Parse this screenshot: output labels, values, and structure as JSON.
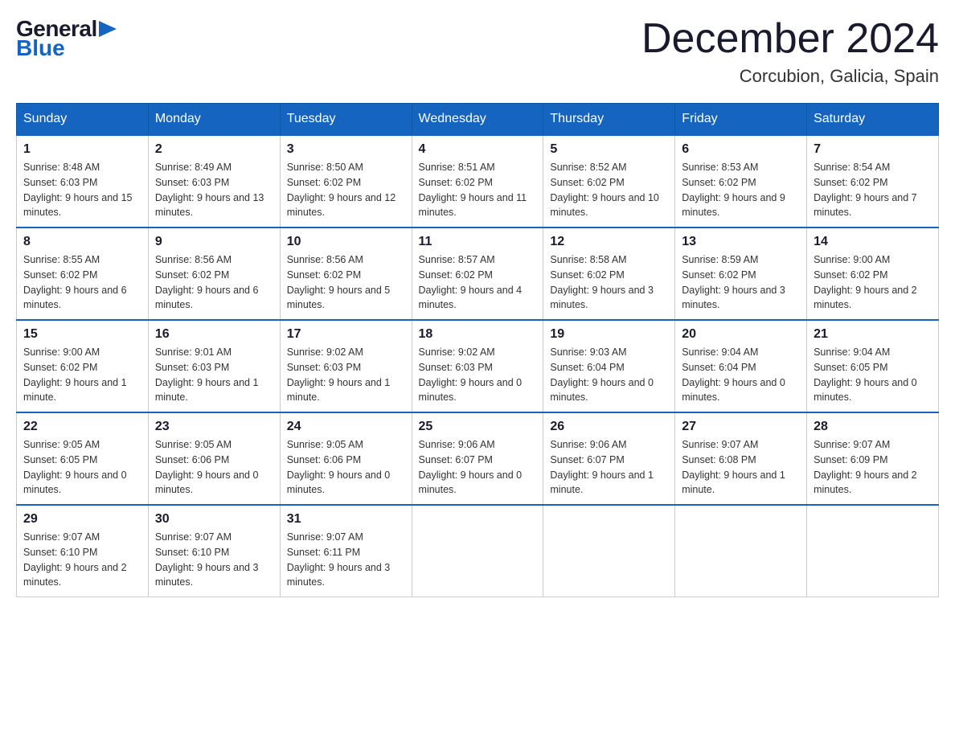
{
  "logo": {
    "general": "General",
    "blue": "Blue"
  },
  "title": "December 2024",
  "location": "Corcubion, Galicia, Spain",
  "days_of_week": [
    "Sunday",
    "Monday",
    "Tuesday",
    "Wednesday",
    "Thursday",
    "Friday",
    "Saturday"
  ],
  "weeks": [
    [
      {
        "day": "1",
        "sunrise": "8:48 AM",
        "sunset": "6:03 PM",
        "daylight": "9 hours and 15 minutes."
      },
      {
        "day": "2",
        "sunrise": "8:49 AM",
        "sunset": "6:03 PM",
        "daylight": "9 hours and 13 minutes."
      },
      {
        "day": "3",
        "sunrise": "8:50 AM",
        "sunset": "6:02 PM",
        "daylight": "9 hours and 12 minutes."
      },
      {
        "day": "4",
        "sunrise": "8:51 AM",
        "sunset": "6:02 PM",
        "daylight": "9 hours and 11 minutes."
      },
      {
        "day": "5",
        "sunrise": "8:52 AM",
        "sunset": "6:02 PM",
        "daylight": "9 hours and 10 minutes."
      },
      {
        "day": "6",
        "sunrise": "8:53 AM",
        "sunset": "6:02 PM",
        "daylight": "9 hours and 9 minutes."
      },
      {
        "day": "7",
        "sunrise": "8:54 AM",
        "sunset": "6:02 PM",
        "daylight": "9 hours and 7 minutes."
      }
    ],
    [
      {
        "day": "8",
        "sunrise": "8:55 AM",
        "sunset": "6:02 PM",
        "daylight": "9 hours and 6 minutes."
      },
      {
        "day": "9",
        "sunrise": "8:56 AM",
        "sunset": "6:02 PM",
        "daylight": "9 hours and 6 minutes."
      },
      {
        "day": "10",
        "sunrise": "8:56 AM",
        "sunset": "6:02 PM",
        "daylight": "9 hours and 5 minutes."
      },
      {
        "day": "11",
        "sunrise": "8:57 AM",
        "sunset": "6:02 PM",
        "daylight": "9 hours and 4 minutes."
      },
      {
        "day": "12",
        "sunrise": "8:58 AM",
        "sunset": "6:02 PM",
        "daylight": "9 hours and 3 minutes."
      },
      {
        "day": "13",
        "sunrise": "8:59 AM",
        "sunset": "6:02 PM",
        "daylight": "9 hours and 3 minutes."
      },
      {
        "day": "14",
        "sunrise": "9:00 AM",
        "sunset": "6:02 PM",
        "daylight": "9 hours and 2 minutes."
      }
    ],
    [
      {
        "day": "15",
        "sunrise": "9:00 AM",
        "sunset": "6:02 PM",
        "daylight": "9 hours and 1 minute."
      },
      {
        "day": "16",
        "sunrise": "9:01 AM",
        "sunset": "6:03 PM",
        "daylight": "9 hours and 1 minute."
      },
      {
        "day": "17",
        "sunrise": "9:02 AM",
        "sunset": "6:03 PM",
        "daylight": "9 hours and 1 minute."
      },
      {
        "day": "18",
        "sunrise": "9:02 AM",
        "sunset": "6:03 PM",
        "daylight": "9 hours and 0 minutes."
      },
      {
        "day": "19",
        "sunrise": "9:03 AM",
        "sunset": "6:04 PM",
        "daylight": "9 hours and 0 minutes."
      },
      {
        "day": "20",
        "sunrise": "9:04 AM",
        "sunset": "6:04 PM",
        "daylight": "9 hours and 0 minutes."
      },
      {
        "day": "21",
        "sunrise": "9:04 AM",
        "sunset": "6:05 PM",
        "daylight": "9 hours and 0 minutes."
      }
    ],
    [
      {
        "day": "22",
        "sunrise": "9:05 AM",
        "sunset": "6:05 PM",
        "daylight": "9 hours and 0 minutes."
      },
      {
        "day": "23",
        "sunrise": "9:05 AM",
        "sunset": "6:06 PM",
        "daylight": "9 hours and 0 minutes."
      },
      {
        "day": "24",
        "sunrise": "9:05 AM",
        "sunset": "6:06 PM",
        "daylight": "9 hours and 0 minutes."
      },
      {
        "day": "25",
        "sunrise": "9:06 AM",
        "sunset": "6:07 PM",
        "daylight": "9 hours and 0 minutes."
      },
      {
        "day": "26",
        "sunrise": "9:06 AM",
        "sunset": "6:07 PM",
        "daylight": "9 hours and 1 minute."
      },
      {
        "day": "27",
        "sunrise": "9:07 AM",
        "sunset": "6:08 PM",
        "daylight": "9 hours and 1 minute."
      },
      {
        "day": "28",
        "sunrise": "9:07 AM",
        "sunset": "6:09 PM",
        "daylight": "9 hours and 2 minutes."
      }
    ],
    [
      {
        "day": "29",
        "sunrise": "9:07 AM",
        "sunset": "6:10 PM",
        "daylight": "9 hours and 2 minutes."
      },
      {
        "day": "30",
        "sunrise": "9:07 AM",
        "sunset": "6:10 PM",
        "daylight": "9 hours and 3 minutes."
      },
      {
        "day": "31",
        "sunrise": "9:07 AM",
        "sunset": "6:11 PM",
        "daylight": "9 hours and 3 minutes."
      },
      null,
      null,
      null,
      null
    ]
  ]
}
